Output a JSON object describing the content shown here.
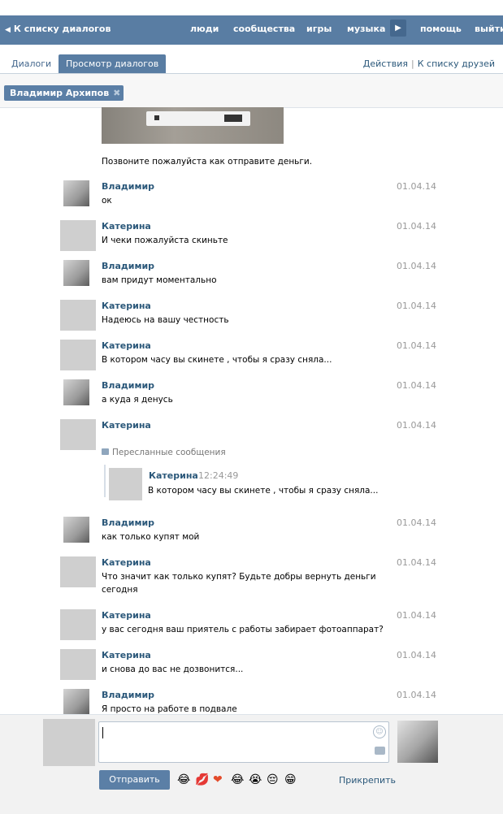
{
  "topbar": {
    "back_label": "К списку диалогов",
    "nav": [
      "люди",
      "сообщества",
      "игры",
      "музыка",
      "помощь",
      "выйти"
    ]
  },
  "tabs": {
    "dialogs": "Диалоги",
    "view": "Просмотр диалогов"
  },
  "right_links": {
    "actions": "Действия",
    "friends": "К списку друзей"
  },
  "peer": {
    "name": "Владимир Архипов"
  },
  "first_message_text": "Позвоните пожалуйста как отправите деньги.",
  "messages": [
    {
      "name": "Владимир",
      "date": "01.04.14",
      "lines": [
        "ок"
      ]
    },
    {
      "name": "Катерина",
      "date": "01.04.14",
      "lines": [
        "И чеки пожалуйста скиньте"
      ]
    },
    {
      "name": "Владимир",
      "date": "01.04.14",
      "lines": [
        "вам придут моментально"
      ]
    },
    {
      "name": "Катерина",
      "date": "01.04.14",
      "lines": [
        "Надеюсь на вашу честность"
      ]
    },
    {
      "name": "Катерина",
      "date": "01.04.14",
      "lines": [
        "В котором часу вы скинете , чтобы я сразу сняла..."
      ]
    },
    {
      "name": "Владимир",
      "date": "01.04.14",
      "lines": [
        "а куда я денусь"
      ]
    },
    {
      "name": "Катерина",
      "date": "01.04.14",
      "lines": []
    },
    {
      "name": "Владимир",
      "date": "01.04.14",
      "lines": [
        "как только купят мой"
      ]
    },
    {
      "name": "Катерина",
      "date": "01.04.14",
      "lines": [
        "Что значит как только купят? Будьте добры вернуть деньги",
        "сегодня"
      ]
    },
    {
      "name": "Катерина",
      "date": "01.04.14",
      "lines": [
        "у вас сегодня ваш приятель с работы забирает фотоаппарат?"
      ]
    },
    {
      "name": "Катерина",
      "date": "01.04.14",
      "lines": [
        "и снова до вас не дозвонится..."
      ]
    },
    {
      "name": "Владимир",
      "date": "01.04.14",
      "lines": [
        "Я просто на работе в подвале"
      ]
    }
  ],
  "forwarded": {
    "label": "Пересланные сообщения",
    "name": "Катерина",
    "time": "12:24:49",
    "text": "В котором часу вы скинете , чтобы я сразу сняла..."
  },
  "composer": {
    "send_label": "Отправить",
    "attach_label": "Прикрепить",
    "emojis": [
      "😂",
      "💋",
      "❤",
      "😂",
      "😭",
      "😔",
      "😁"
    ]
  },
  "colors": {
    "accent": "#597da3",
    "link": "#2b587a",
    "date": "#999999"
  }
}
